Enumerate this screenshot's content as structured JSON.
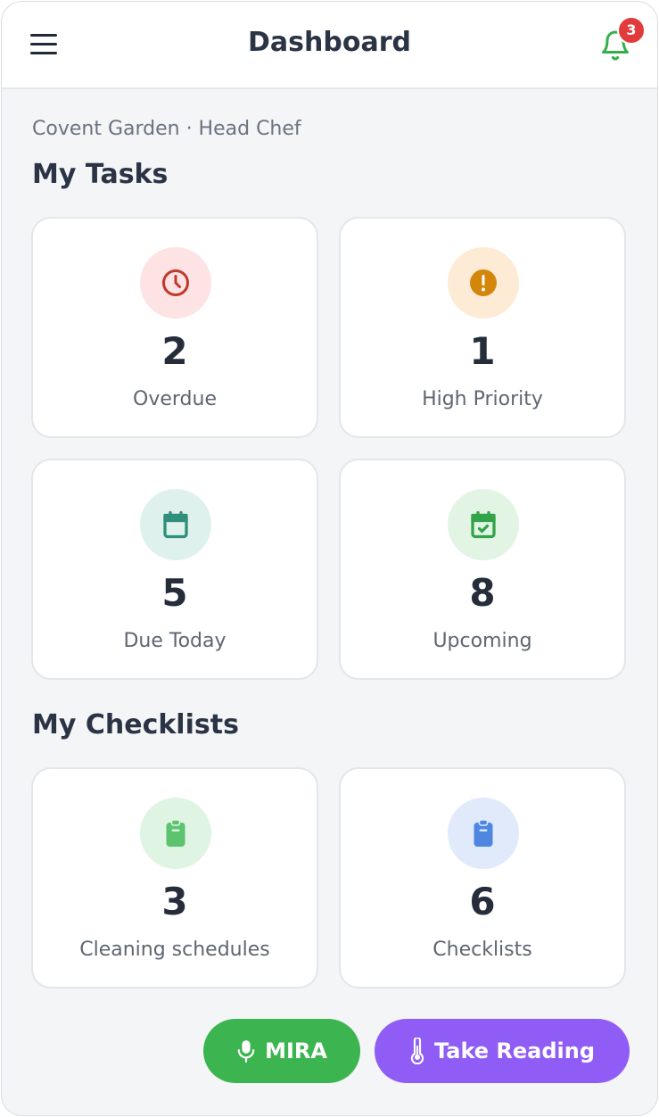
{
  "header": {
    "title": "Dashboard",
    "notification_count": "3"
  },
  "subtitle": "Covent Garden · Head Chef",
  "tasks": {
    "heading": "My Tasks",
    "cards": [
      {
        "count": "2",
        "label": "Overdue",
        "icon": "clock-icon",
        "color": "#c0392b",
        "bg": "#fde3e3"
      },
      {
        "count": "1",
        "label": "High Priority",
        "icon": "alert-icon",
        "color": "#d4860b",
        "bg": "#fdebd6"
      },
      {
        "count": "5",
        "label": "Due Today",
        "icon": "calendar-icon",
        "color": "#2f8f7a",
        "bg": "#dff1ed"
      },
      {
        "count": "8",
        "label": "Upcoming",
        "icon": "calendar-check-icon",
        "color": "#33a34a",
        "bg": "#e2f5e4"
      }
    ]
  },
  "checklists": {
    "heading": "My Checklists",
    "cards": [
      {
        "count": "3",
        "label": "Cleaning schedules",
        "icon": "clipboard-icon",
        "color": "#5cc36e",
        "bg": "#e0f4e3"
      },
      {
        "count": "6",
        "label": "Checklists",
        "icon": "clipboard-icon",
        "color": "#4e86e0",
        "bg": "#e0eafb"
      }
    ]
  },
  "actions": {
    "mira": {
      "label": "MIRA",
      "color": "#3cb44f"
    },
    "reading": {
      "label": "Take Reading",
      "color": "#8f5cf5"
    }
  }
}
